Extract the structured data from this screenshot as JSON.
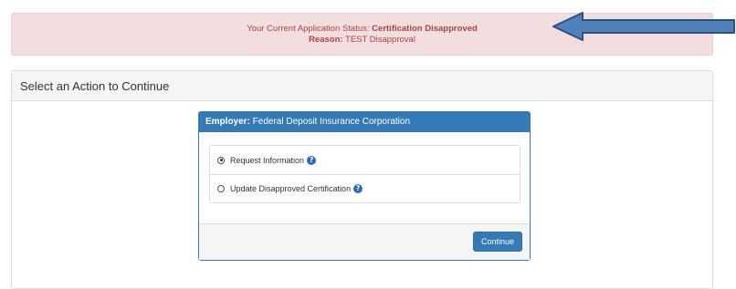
{
  "status_alert": {
    "status_prefix": "Your Current Application Status: ",
    "status_value": "Certification Disapproved",
    "reason_label": "Reason:",
    "reason_value": " TEST Disapproval"
  },
  "action_panel": {
    "title": "Select an Action to Continue",
    "employer_label": "Employer:",
    "employer_name": " Federal Deposit Insurance Corporation",
    "options": [
      {
        "label": "Request Information",
        "selected": true
      },
      {
        "label": "Update Disapproved Certification",
        "selected": false
      }
    ],
    "help_glyph": "?",
    "continue_label": "Continue"
  },
  "colors": {
    "alert_bg": "#f2dede",
    "alert_text": "#a94442",
    "primary": "#337ab7",
    "arrow_fill": "#4f81bd",
    "arrow_stroke": "#2f4f7f"
  }
}
